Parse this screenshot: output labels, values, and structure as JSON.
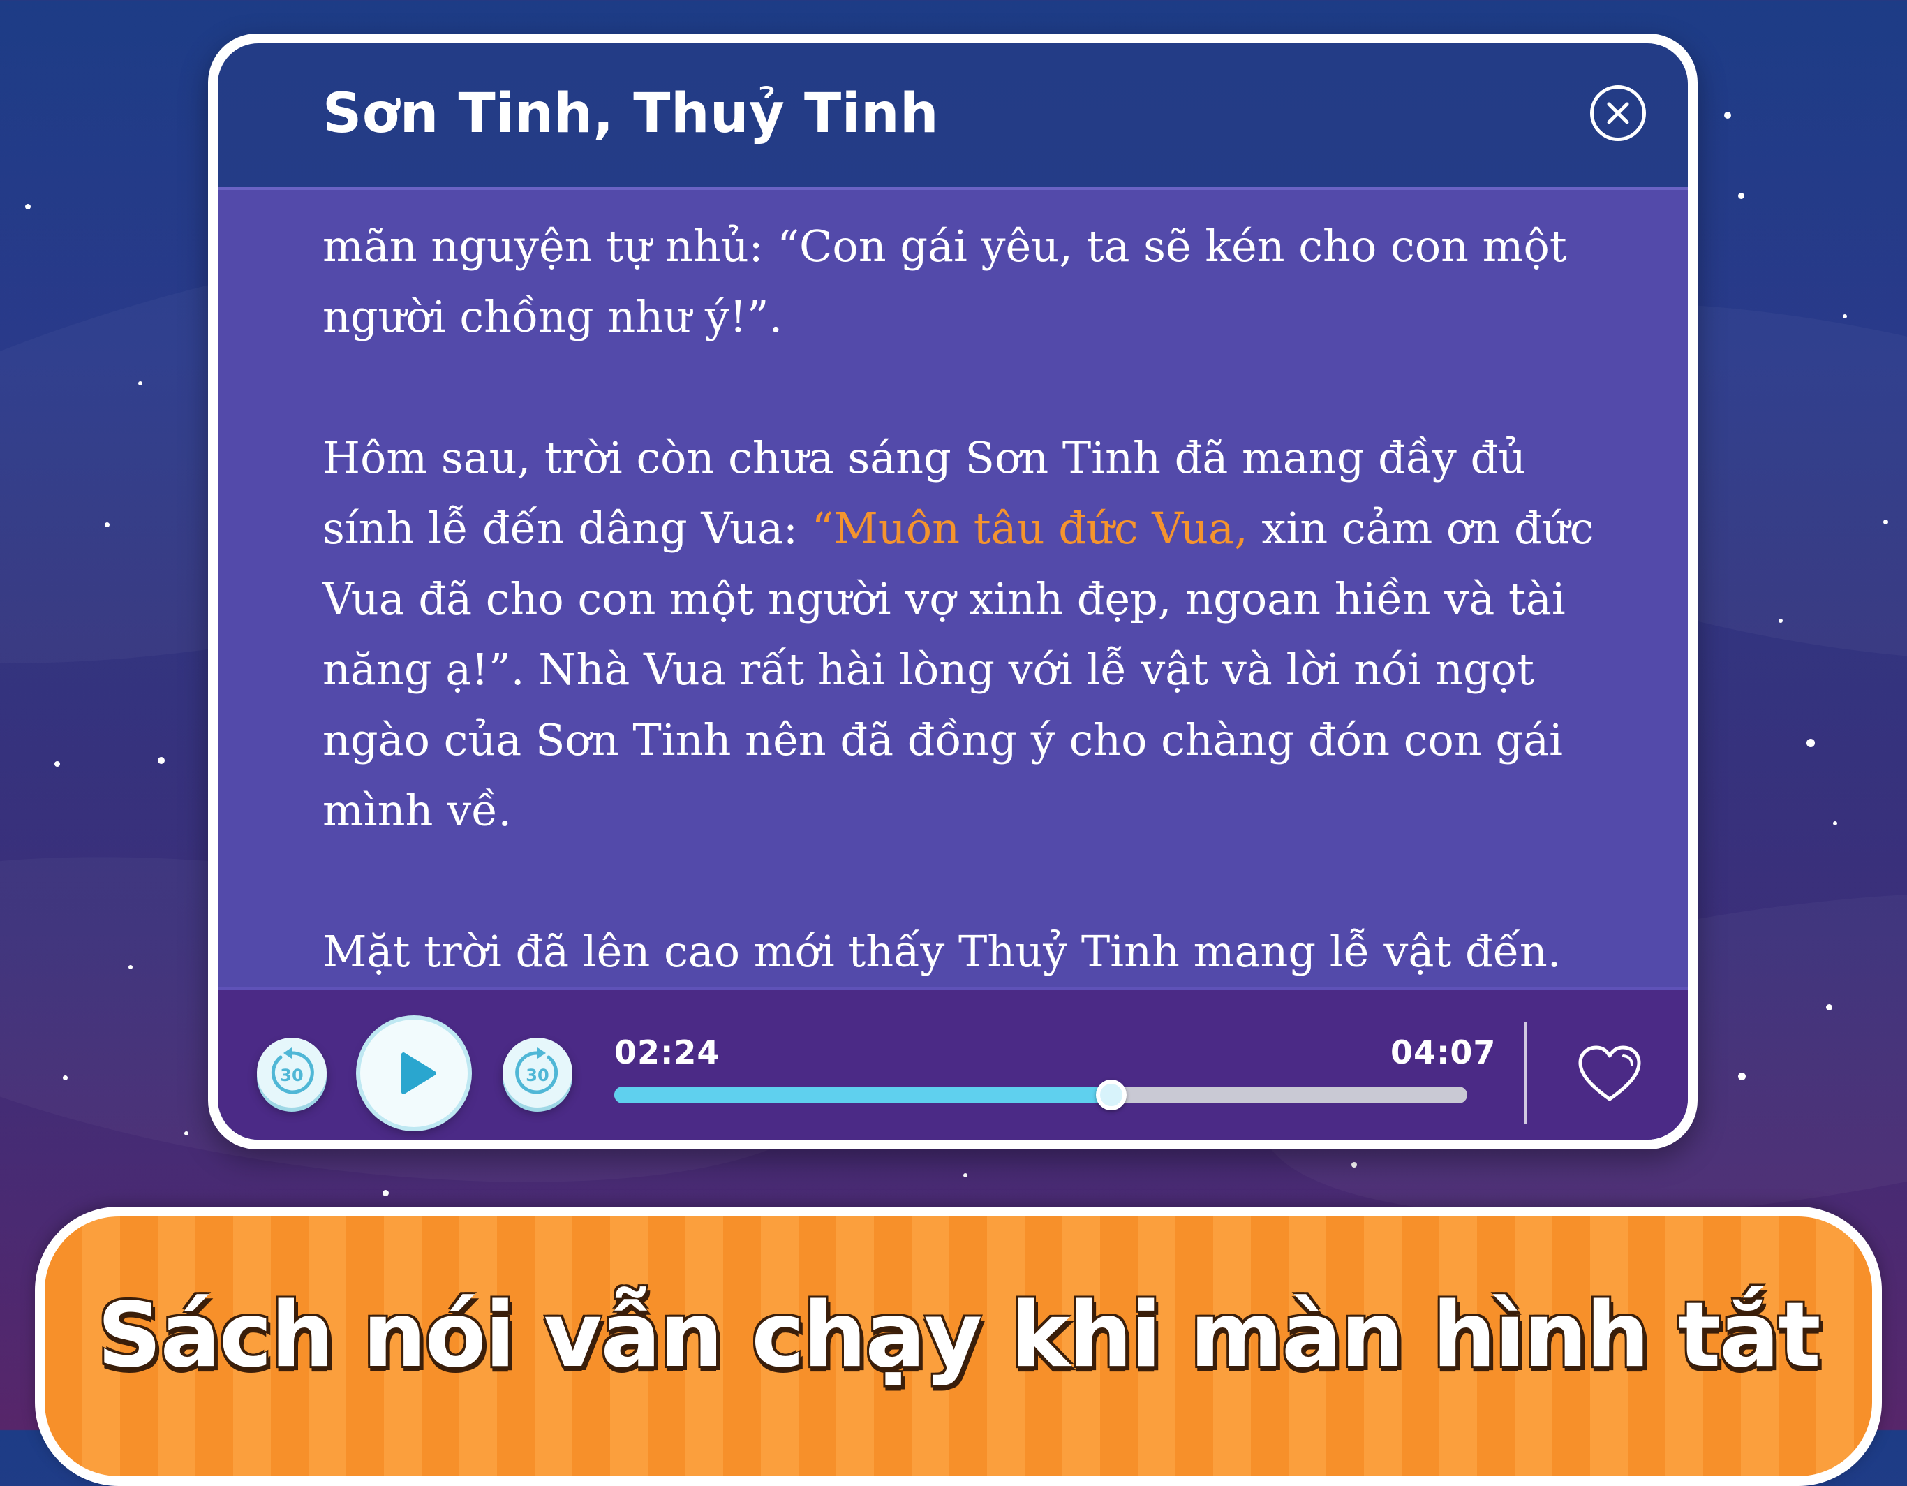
{
  "story": {
    "title": "Sơn Tinh, Thuỷ Tinh",
    "paragraph1": "mãn nguyện tự nhủ: “Con gái yêu, ta sẽ kén cho con một người chồng như ý!”.",
    "paragraph2_before": "Hôm sau, trời còn chưa sáng Sơn Tinh đã mang đầy đủ sính lễ đến dâng Vua: ",
    "paragraph2_highlight": "“Muôn tâu đức Vua,",
    "paragraph2_after": " xin cảm ơn đức Vua đã cho con một người vợ xinh đẹp, ngoan hiền và tài năng ạ!”. Nhà Vua rất hài lòng với lễ vật và lời nói ngọt ngào của Sơn Tinh nên đã đồng ý cho chàng đón con gái mình về.",
    "paragraph3": "Mặt trời đã lên cao mới thấy Thuỷ Tinh mang lễ vật đến."
  },
  "player": {
    "rewind_label": "30",
    "forward_label": "30",
    "current_time": "02:24",
    "total_time": "04:07",
    "progress": 0.583
  },
  "icons": {
    "close": "close-icon",
    "rewind": "rewind-30-icon",
    "play": "play-icon",
    "forward": "forward-30-icon",
    "favorite": "heart-icon"
  },
  "colors": {
    "highlight": "#f5942e",
    "progress_fill": "#5fd0ee",
    "reader_background": "#534aaa",
    "banner": "#f7902a"
  },
  "banner": {
    "text": "Sách nói vẫn chạy khi màn hình tắt"
  }
}
